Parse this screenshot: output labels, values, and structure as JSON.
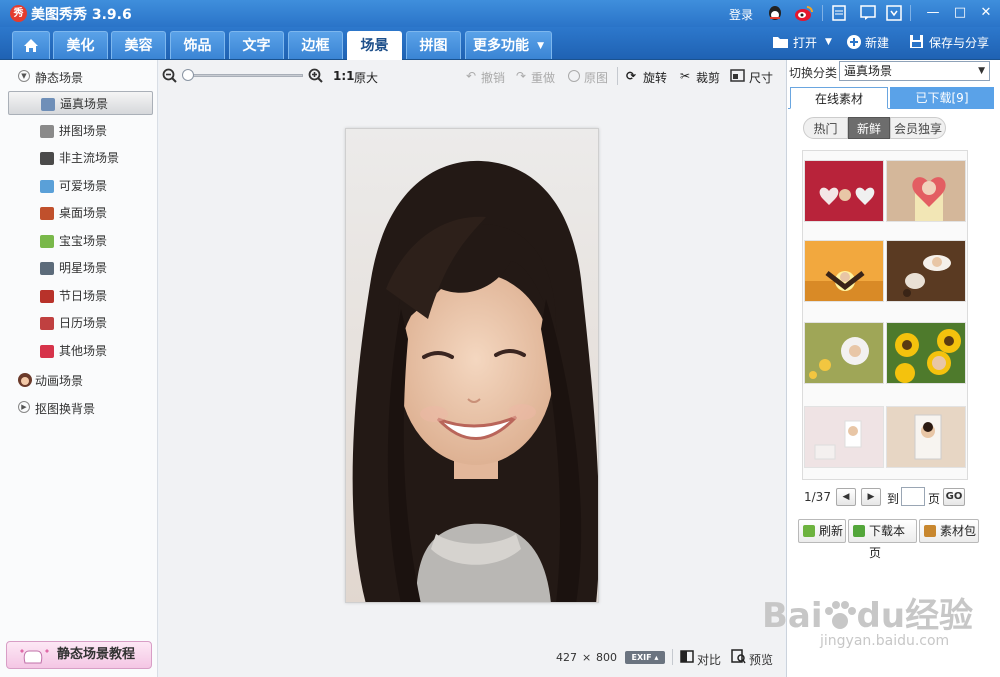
{
  "app": {
    "title": "美图秀秀 3.9.6",
    "logo_glyph": "秀"
  },
  "titlebar": {
    "login": "登录",
    "icons": [
      "qq-icon",
      "weibo-icon",
      "file-icon",
      "message-icon",
      "settings-icon"
    ],
    "window_buttons": [
      "minimize",
      "maximize",
      "close"
    ]
  },
  "tabs": [
    {
      "label": "",
      "icon": "home-icon"
    },
    {
      "label": "美化"
    },
    {
      "label": "美容"
    },
    {
      "label": "饰品"
    },
    {
      "label": "文字"
    },
    {
      "label": "边框"
    },
    {
      "label": "场景",
      "active": true
    },
    {
      "label": "拼图"
    },
    {
      "label": "更多功能"
    }
  ],
  "actions": {
    "open": "打开",
    "new": "新建",
    "save_share": "保存与分享"
  },
  "sidebar": {
    "static_header": "静态场景",
    "items": [
      {
        "label": "逼真场景",
        "selected": true,
        "color": "#6f8fb8"
      },
      {
        "label": "拼图场景",
        "color": "#8a8a8a"
      },
      {
        "label": "非主流场景",
        "color": "#4a4a4a"
      },
      {
        "label": "可爱场景",
        "color": "#5aa0d8"
      },
      {
        "label": "桌面场景",
        "color": "#c0502c"
      },
      {
        "label": "宝宝场景",
        "color": "#79b84a"
      },
      {
        "label": "明星场景",
        "color": "#5c6b7a"
      },
      {
        "label": "节日场景",
        "color": "#b8322a"
      },
      {
        "label": "日历场景",
        "color": "#c04040"
      },
      {
        "label": "其他场景",
        "color": "#d6334a"
      }
    ],
    "animated": "动画场景",
    "matting": "抠图换背景",
    "tutorial": "静态场景教程"
  },
  "toolbar": {
    "zoom_label": "1:1",
    "original_size": "原大",
    "undo": "撤销",
    "redo": "重做",
    "original": "原图",
    "rotate": "旋转",
    "crop": "裁剪",
    "size": "尺寸"
  },
  "status": {
    "width": "427",
    "times": "×",
    "height": "800",
    "exif": "EXIF",
    "compare": "对比",
    "preview": "预览"
  },
  "right_panel": {
    "switch_label": "切换分类",
    "category": "逼真场景",
    "tab_online": "在线素材",
    "tab_downloaded": "已下载[9]",
    "filters": [
      "热门",
      "新鲜",
      "会员独享"
    ],
    "active_filter": 1,
    "page": "1/37",
    "goto_label": "到",
    "page_label": "页",
    "go": "GO",
    "refresh": "刷新",
    "download_page": "下载本页",
    "material_pack": "素材包"
  },
  "watermark": {
    "line1": "Bai",
    "line1b": "du",
    "line1c": "经验",
    "line2": "jingyan.baidu.com"
  },
  "colors": {
    "accent": "#2a74c8",
    "tab_bg": "#3a84d4"
  }
}
